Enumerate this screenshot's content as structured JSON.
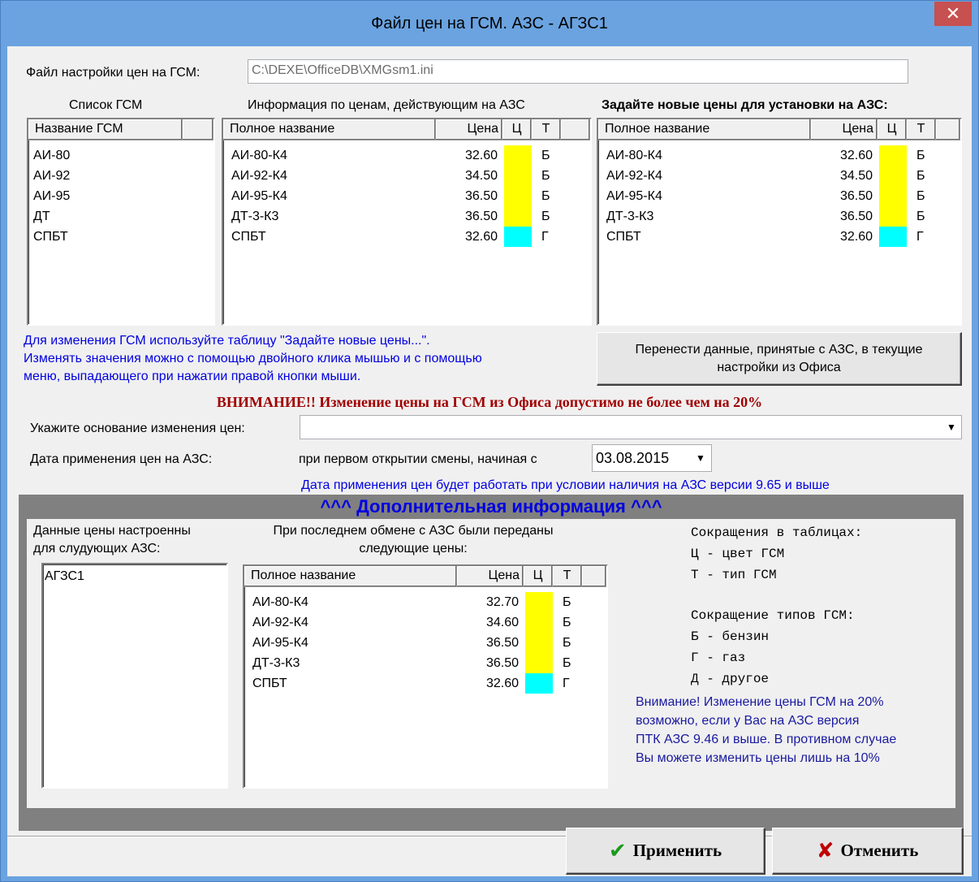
{
  "window": {
    "title": "Файл цен на ГСМ. АЗС - АГЗС1",
    "close_label": "✕"
  },
  "settings_file": {
    "label": "Файл настройки цен на ГСМ:",
    "value": "C:\\DEXE\\OfficeDB\\XMGsm1.ini"
  },
  "fuel_list": {
    "caption": "Список ГСМ",
    "header": "Название ГСМ",
    "items": [
      "АИ-80",
      "АИ-92",
      "АИ-95",
      "ДТ",
      "СПБТ"
    ]
  },
  "columns": {
    "full_name": "Полное название",
    "price": "Цена",
    "color": "Ц",
    "type": "Т"
  },
  "current_prices": {
    "caption": "Информация по ценам, действующим на АЗС",
    "rows": [
      {
        "name": "АИ-80-К4",
        "price": "32.60",
        "color": "#ffff00",
        "type": "Б"
      },
      {
        "name": "АИ-92-К4",
        "price": "34.50",
        "color": "#ffff00",
        "type": "Б"
      },
      {
        "name": "АИ-95-К4",
        "price": "36.50",
        "color": "#ffff00",
        "type": "Б"
      },
      {
        "name": "ДТ-3-К3",
        "price": "36.50",
        "color": "#ffff00",
        "type": "Б"
      },
      {
        "name": "СПБТ",
        "price": "32.60",
        "color": "#00ffff",
        "type": "Г"
      }
    ]
  },
  "new_prices": {
    "caption": "Задайте новые цены для установки на АЗС:",
    "rows": [
      {
        "name": "АИ-80-К4",
        "price": "32.60",
        "color": "#ffff00",
        "type": "Б"
      },
      {
        "name": "АИ-92-К4",
        "price": "34.50",
        "color": "#ffff00",
        "type": "Б"
      },
      {
        "name": "АИ-95-К4",
        "price": "36.50",
        "color": "#ffff00",
        "type": "Б"
      },
      {
        "name": "ДТ-3-К3",
        "price": "36.50",
        "color": "#ffff00",
        "type": "Б"
      },
      {
        "name": "СПБТ",
        "price": "32.60",
        "color": "#00ffff",
        "type": "Г"
      }
    ]
  },
  "hint": {
    "line1": "Для изменения ГСМ используйте таблицу \"Задайте новые цены...\".",
    "line2": "Изменять значения можно с помощью двойного клика мышью и с помощью",
    "line3": "меню, выпадающего при нажатии правой кнопки мыши."
  },
  "transfer_button": {
    "line1": "Перенести данные, принятые с АЗС, в текущие",
    "line2": "настройки из Офиса"
  },
  "warning": "ВНИМАНИЕ!! Изменение цены  на ГСМ из Офиса допустимо не более чем на 20%",
  "reason": {
    "label": "Укажите основание изменения цен:",
    "value": ""
  },
  "apply_date": {
    "label": "Дата применения цен на АЗС:",
    "mode_text": "при первом открытии смены, начиная с",
    "value": "03.08.2015",
    "note": "Дата применения цен будет работать при условии наличия на АЗС версии 9.65 и выше"
  },
  "extra": {
    "title": "^^^  Дополнительная информация  ^^^",
    "stations_caption_1": "Данные цены настроенны",
    "stations_caption_2": "для слудующих АЗС:",
    "stations": [
      "АГЗС1"
    ],
    "last_exchange_caption_1": "При последнем обмене с АЗС были переданы",
    "last_exchange_caption_2": "следующие цены:",
    "last_exchange_rows": [
      {
        "name": "АИ-80-К4",
        "price": "32.70",
        "color": "#ffff00",
        "type": "Б"
      },
      {
        "name": "АИ-92-К4",
        "price": "34.60",
        "color": "#ffff00",
        "type": "Б"
      },
      {
        "name": "АИ-95-К4",
        "price": "36.50",
        "color": "#ffff00",
        "type": "Б"
      },
      {
        "name": "ДТ-3-К3",
        "price": "36.50",
        "color": "#ffff00",
        "type": "Б"
      },
      {
        "name": "СПБТ",
        "price": "32.60",
        "color": "#00ffff",
        "type": "Г"
      }
    ],
    "legend": {
      "abbr_title": "Сокращения в таблицах:",
      "abbr_color": "Ц - цвет ГСМ",
      "abbr_type": "Т - тип ГСМ",
      "types_title": "Сокращение типов ГСМ:",
      "type_b": "Б - бензин",
      "type_g": "Г - газ",
      "type_d": "Д - другое"
    },
    "attention": {
      "line1": "Внимание! Изменение цены ГСМ на 20%",
      "line2": "возможно, если у Вас на АЗС версия",
      "line3": "ПТК АЗС 9.46 и выше. В противном случае",
      "line4": "Вы можете изменить цены лишь на 10%"
    }
  },
  "buttons": {
    "apply": "Применить",
    "cancel": "Отменить"
  },
  "colors": {
    "title_bar": "#6aa3e0",
    "close": "#c75050",
    "warning": "#a00000",
    "hint": "#0000e0",
    "panel_frame": "#808080"
  }
}
